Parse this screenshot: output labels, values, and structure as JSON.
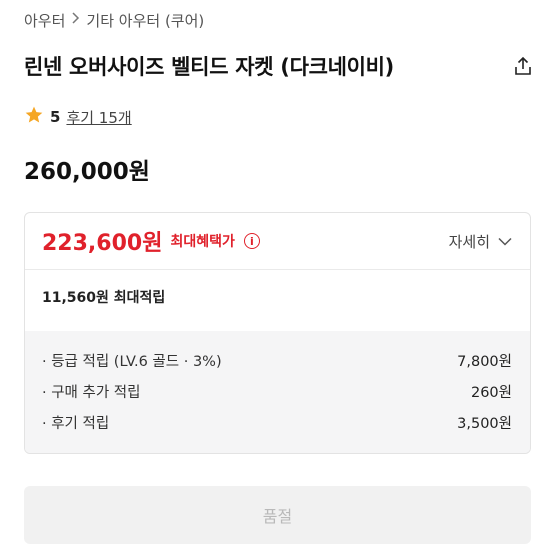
{
  "breadcrumb": {
    "level1": "아우터",
    "level2": "기타 아우터 (쿠어)"
  },
  "product": {
    "title": "린넨 오버사이즈 벨티드 자켓 (다크네이비)",
    "rating_score": "5",
    "review_link": "후기 15개",
    "price": "260,000원"
  },
  "benefit": {
    "price": "223,600원",
    "label": "최대혜택가",
    "info_icon": "i",
    "detail_label": "자세히"
  },
  "points": {
    "total_label": "11,560원 최대적립",
    "rows": [
      {
        "label": "· 등급 적립 (LV.6 골드 · 3%)",
        "value": "7,800원"
      },
      {
        "label": "· 구매 추가 적립",
        "value": "260원"
      },
      {
        "label": "· 후기 적립",
        "value": "3,500원"
      }
    ]
  },
  "actions": {
    "soldout_label": "품절"
  },
  "colors": {
    "accent_red": "#e0212b",
    "star": "#f5a623"
  }
}
